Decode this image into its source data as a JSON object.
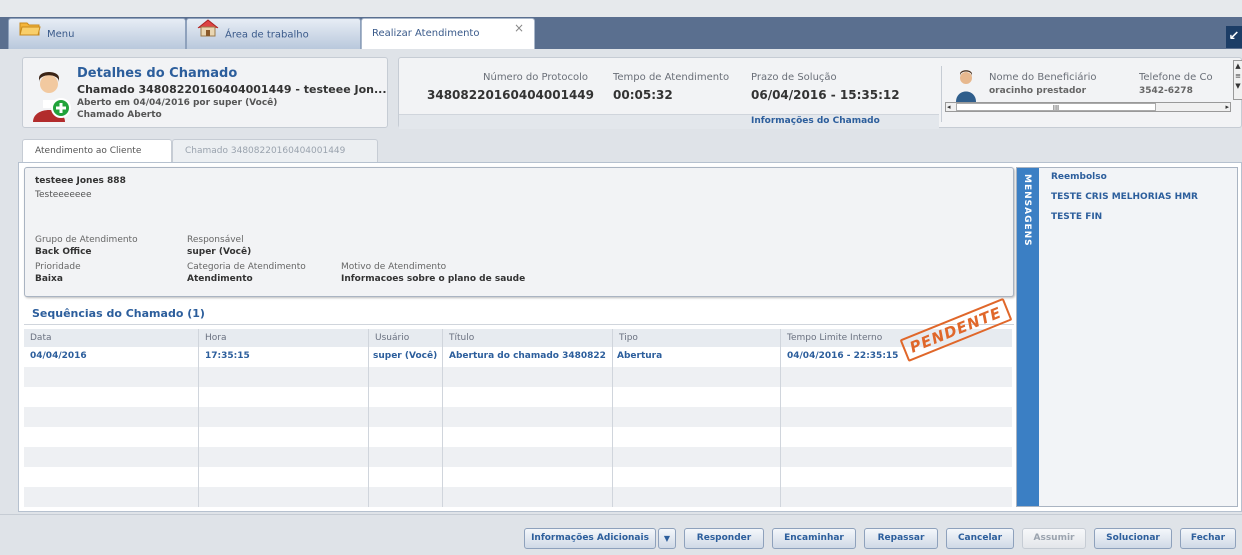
{
  "tabs": [
    {
      "label": "Menu"
    },
    {
      "label": "Área de trabalho"
    },
    {
      "label": "Realizar Atendimento"
    }
  ],
  "details": {
    "title": "Detalhes do Chamado",
    "line1": "Chamado 34808220160404001449 - testeee Jon...",
    "line2": "Aberto em 04/04/2016 por super (Você)",
    "line3": "Chamado Aberto"
  },
  "protocol": {
    "numero_label": "Número do Protocolo",
    "numero_value": "34808220160404001449",
    "tempo_label": "Tempo de Atendimento",
    "tempo_value": "00:05:32",
    "prazo_label": "Prazo de Solução",
    "prazo_value": "06/04/2016 - 15:35:12",
    "info_link": "Informações do Chamado"
  },
  "beneficiario": {
    "nome_label": "Nome do Beneficiário",
    "nome_value": "oracinho prestador",
    "tel_label": "Telefone de Co",
    "tel_value": "3542-6278",
    "scroll_mark": "III"
  },
  "content_tabs": [
    {
      "label": "Atendimento ao Cliente"
    },
    {
      "label": "Chamado 34808220160404001449"
    }
  ],
  "atendimento": {
    "nome": "testeee Jones 888",
    "desc": "Testeeeeeee",
    "grupo_label": "Grupo de Atendimento",
    "grupo_value": "Back Office",
    "resp_label": "Responsável",
    "resp_value": "super (Você)",
    "prio_label": "Prioridade",
    "prio_value": "Baixa",
    "cat_label": "Categoria de Atendimento",
    "cat_value": "Atendimento",
    "motivo_label": "Motivo de Atendimento",
    "motivo_value": "Informacoes sobre o plano de saude"
  },
  "sequencias": {
    "title": "Sequências do Chamado (1)",
    "headers": [
      "Data",
      "Hora",
      "Usuário",
      "Título",
      "Tipo",
      "Tempo Limite Interno"
    ],
    "rows": [
      [
        "04/04/2016",
        "17:35:15",
        "super (Você)",
        "Abertura do chamado 3480822",
        "Abertura",
        "04/04/2016 - 22:35:15"
      ]
    ],
    "stamp": "PENDENTE"
  },
  "mensagens": {
    "tab_label": "MENSAGENS",
    "items": [
      "Reembolso",
      "TESTE CRIS MELHORIAS HMR",
      "TESTE FIN"
    ]
  },
  "buttons": {
    "info": "Informações Adicionais",
    "responder": "Responder",
    "encaminhar": "Encaminhar",
    "repassar": "Repassar",
    "cancelar": "Cancelar",
    "assumir": "Assumir",
    "solucionar": "Solucionar",
    "fechar": "Fechar"
  },
  "colors": {
    "accent": "#2c5e9c",
    "tabstrip": "#5a6f8f",
    "stamp": "#e0672a",
    "mensagens_bar": "#3b7fc4"
  }
}
